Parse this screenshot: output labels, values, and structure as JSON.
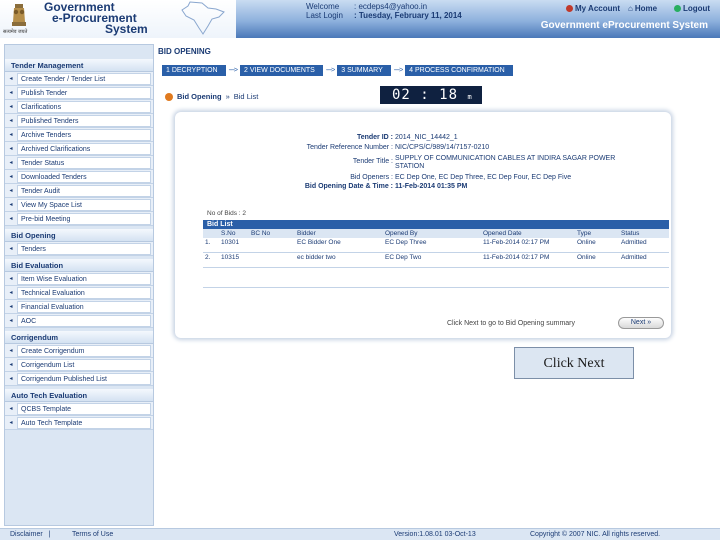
{
  "header": {
    "brand_line1": "Government",
    "brand_line2": "e-Procurement",
    "brand_line3": "System",
    "emblem_caption": "सत्यमेव जयते",
    "welcome_label": "Welcome",
    "welcome_value": ":  ecdeps4@yahoo.in",
    "last_login_label": "Last Login",
    "last_login_value": ":  Tuesday, February 11, 2014",
    "my_account": "My Account",
    "home": "Home",
    "logout": "Logout",
    "system_title": "Government eProcurement System",
    "accent_color": "#2a5fa8"
  },
  "sidebar": {
    "sections": [
      {
        "title": "Tender Management",
        "items": [
          "Create Tender / Tender List",
          "Publish Tender",
          "Clarifications",
          "Published Tenders",
          "Archive Tenders",
          "Archived Clarifications",
          "Tender Status",
          "Downloaded Tenders",
          "Tender Audit",
          "View My Space List",
          "Pre-bid Meeting"
        ]
      },
      {
        "title": "Bid Opening",
        "items": [
          "Tenders"
        ]
      },
      {
        "title": "Bid Evaluation",
        "items": [
          "Item Wise Evaluation",
          "Technical Evaluation",
          "Financial Evaluation",
          "AOC"
        ]
      },
      {
        "title": "Corrigendum",
        "items": [
          "Create Corrigendum",
          "Corrigendum List",
          "Corrigendum Published List"
        ]
      },
      {
        "title": "Auto Tech Evaluation",
        "items": [
          "QCBS Template",
          "Auto Tech Template"
        ]
      }
    ]
  },
  "main": {
    "page_title": "BID OPENING",
    "steps": [
      "1  DECRYPTION",
      "2  VIEW DOCUMENTS",
      "3  SUMMARY",
      "4  PROCESS CONFIRMATION"
    ],
    "breadcrumb_1": "Bid Opening",
    "breadcrumb_sep": "»",
    "breadcrumb_2": "Bid List",
    "timer": "02 : 18",
    "timer_unit": "m",
    "tender_id_label": "Tender ID :",
    "tender_id_value": "2014_NIC_14442_1",
    "tender_ref_label": "Tender Reference Number :",
    "tender_ref_value": "NIC/CPS/C/989/14/7157-0210",
    "tender_title_label": "Tender Title :",
    "tender_title_value": "SUPPLY OF COMMUNICATION CABLES AT INDIRA SAGAR POWER STATION",
    "bid_openers_label": "Bid Openers :",
    "bid_openers_value": "EC Dep One, EC Dep Three, EC Dep Four, EC Dep Five",
    "bid_opening_date_label": "Bid Opening Date & Time :",
    "bid_opening_date_value": "11-Feb-2014 01:35 PM",
    "rows_count": "No of Bids : 2",
    "bid_list_title": "Bid List",
    "columns": [
      "S.No",
      "BC No",
      "Bidder",
      "Opened By",
      "Opened Date",
      "Type",
      "Status"
    ],
    "rows": [
      {
        "check": "1.",
        "sno": "",
        "bc": "10301",
        "bidder": "EC Bidder One",
        "opened_by": "EC Dep Three",
        "opened_date": "11-Feb-2014 02:17 PM",
        "type": "Online",
        "status": "Admitted"
      },
      {
        "check": "2.",
        "sno": "",
        "bc": "10315",
        "bidder": "ec bidder two",
        "opened_by": "EC Dep Two",
        "opened_date": "11-Feb-2014 02:17 PM",
        "type": "Online",
        "status": "Admitted"
      }
    ],
    "next_hint": "Click Next to go to Bid Opening summary",
    "next_button": "Next »",
    "callout": "Click Next"
  },
  "footer": {
    "disclaimer": "Disclaimer",
    "sep": "|",
    "terms": "Terms of Use",
    "version": "Version:1.08.01 03-Oct-13",
    "copyright": "Copyright © 2007 NIC. All rights reserved."
  }
}
